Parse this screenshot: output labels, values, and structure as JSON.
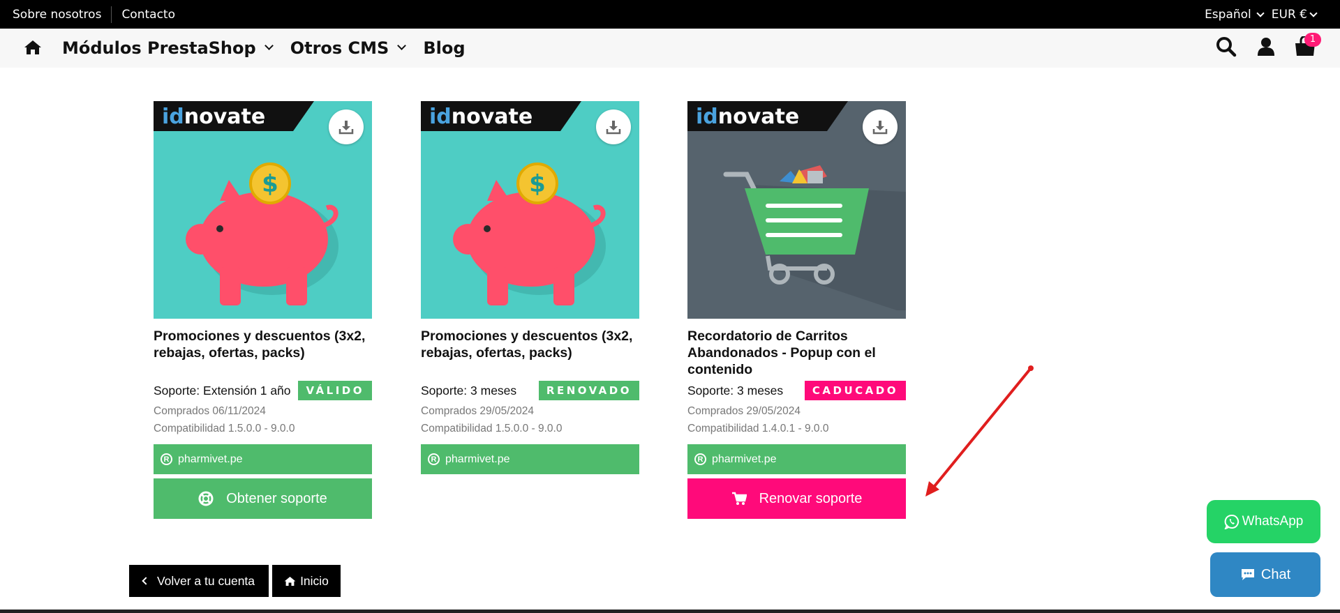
{
  "topbar": {
    "about": "Sobre nosotros",
    "contact": "Contacto",
    "language": "Español",
    "currency": "EUR €"
  },
  "nav": {
    "modules": "Módulos PrestaShop",
    "other_cms": "Otros CMS",
    "blog": "Blog",
    "cart_count": "1"
  },
  "cards": [
    {
      "brand": "idnovate",
      "title": "Promociones y descuentos (3x2, rebajas, ofertas, packs)",
      "support": "Soporte: Extensión 1 año",
      "status": "VÁLIDO",
      "status_color": "#4fbb6c",
      "bought": "Comprados 06/11/2024",
      "compat": "Compatibilidad 1.5.0.0 - 9.0.0",
      "domain": "pharmivet.pe",
      "action": "Obtener soporte",
      "action_color": "#4fbb6c"
    },
    {
      "brand": "idnovate",
      "title": "Promociones y descuentos (3x2, rebajas, ofertas, packs)",
      "support": "Soporte: 3 meses",
      "status": "RENOVADO",
      "status_color": "#4fbb6c",
      "bought": "Comprados 29/05/2024",
      "compat": "Compatibilidad 1.5.0.0 - 9.0.0",
      "domain": "pharmivet.pe"
    },
    {
      "brand": "idnovate",
      "title": "Recordatorio de Carritos Abandonados - Popup con el contenido",
      "support": "Soporte: 3 meses",
      "status": "CADUCADO",
      "status_color": "#ff0a7a",
      "bought": "Comprados 29/05/2024",
      "compat": "Compatibilidad 1.4.0.1 - 9.0.0",
      "domain": "pharmivet.pe",
      "action": "Renovar soporte",
      "action_color": "#ff0a7a"
    }
  ],
  "footer": {
    "back": "Volver a tu cuenta",
    "home": "Inicio"
  },
  "floating": {
    "whatsapp": "WhatsApp",
    "chat": "Chat"
  },
  "icons": [
    "home-icon",
    "search-icon",
    "user-icon",
    "cart-icon",
    "download-icon",
    "lifebuoy-icon",
    "cart-icon",
    "whatsapp-icon",
    "chat-icon"
  ]
}
